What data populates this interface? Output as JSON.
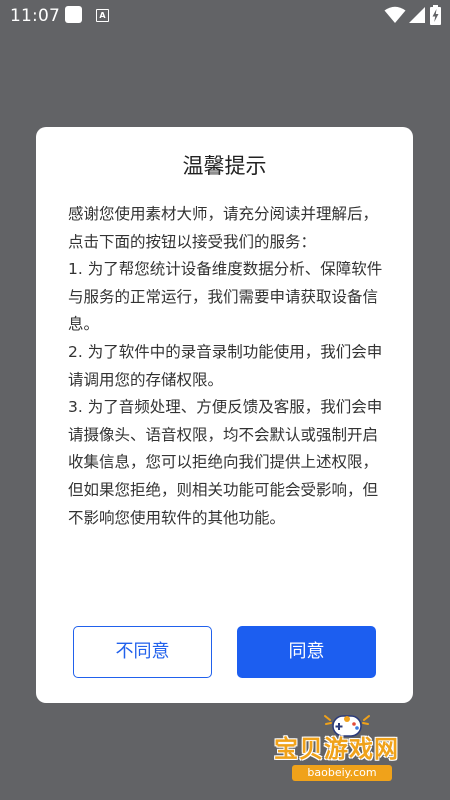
{
  "status_bar": {
    "time": "11:07",
    "a_icon_letter": "A"
  },
  "dialog": {
    "title": "温馨提示",
    "paragraphs": [
      "感谢您使用素材大师，请充分阅读并理解后，点击下面的按钮以接受我们的服务：",
      "1. 为了帮您统计设备维度数据分析、保障软件与服务的正常运行，我们需要申请获取设备信息。",
      "2. 为了软件中的录音录制功能使用，我们会申请调用您的存储权限。",
      "3. 为了音频处理、方便反馈及客服，我们会申请摄像头、语音权限，均不会默认或强制开启收集信息，您可以拒绝向我们提供上述权限，但如果您拒绝，则相关功能可能会受影响，但不影响您使用软件的其他功能。"
    ],
    "disagree_label": "不同意",
    "agree_label": "同意"
  },
  "watermark": {
    "brand": "宝贝游戏网",
    "url": "baobeiy.com"
  },
  "colors": {
    "overlay": "#626366",
    "accent": "#1c5ef0",
    "watermark": "#f0a21a"
  }
}
